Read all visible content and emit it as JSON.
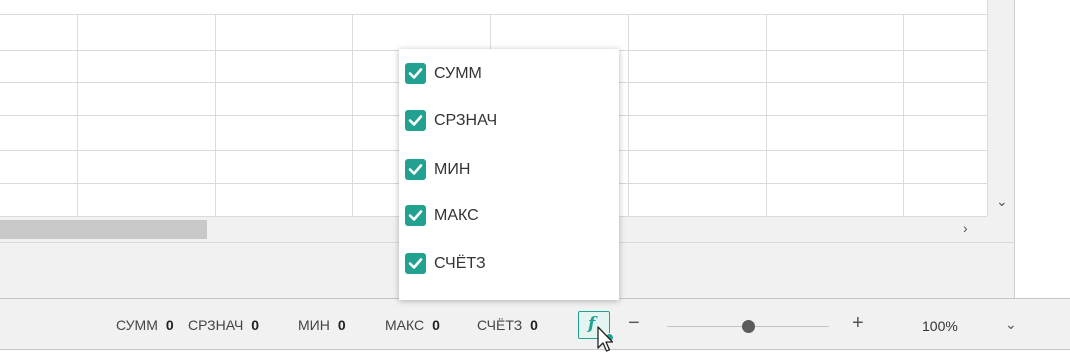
{
  "status_bar": {
    "stats": [
      {
        "label": "СУММ",
        "value": "0"
      },
      {
        "label": "СРЗНАЧ",
        "value": "0"
      },
      {
        "label": "МИН",
        "value": "0"
      },
      {
        "label": "МАКС",
        "value": "0"
      },
      {
        "label": "СЧЁТЗ",
        "value": "0"
      }
    ],
    "function_button_icon": "function-icon",
    "zoom": {
      "minus_label": "−",
      "plus_label": "+",
      "value": "100%",
      "level": 0.5,
      "dropdown_icon": "chevron-down-icon"
    }
  },
  "function_menu": {
    "items": [
      {
        "label": "СУММ",
        "checked": true
      },
      {
        "label": "СРЗНАЧ",
        "checked": true
      },
      {
        "label": "МИН",
        "checked": true
      },
      {
        "label": "МАКС",
        "checked": true
      },
      {
        "label": "СЧЁТЗ",
        "checked": true
      }
    ]
  },
  "scrollbars": {
    "vertical_down_icon": "chevron-down-icon",
    "horizontal_right_icon": "chevron-right-icon"
  },
  "colors": {
    "accent": "#22a191",
    "grid_line": "#dadada",
    "bar_background": "#f1f1f1"
  }
}
